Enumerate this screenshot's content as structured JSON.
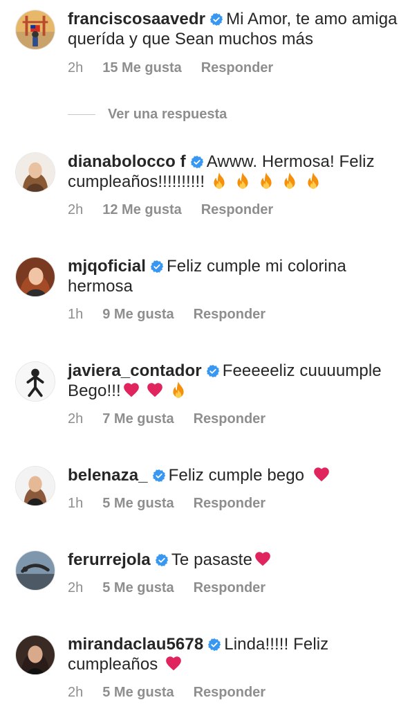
{
  "comments": [
    {
      "username": "franciscosaavedr",
      "text": "Mi Amor, te amo amiga querída y que Sean muchos más",
      "time": "2h",
      "likes": "15 Me gusta",
      "reply": "Responder",
      "emojis": []
    },
    {
      "username": "dianabolocco f",
      "text": "Awww. Hermosa! Feliz cumpleaños!!!!!!!!!!",
      "time": "2h",
      "likes": "12 Me gusta",
      "reply": "Responder",
      "emojis": [
        "fire-icon",
        "fire-icon",
        "fire-icon",
        "fire-icon",
        "fire-icon"
      ]
    },
    {
      "username": "mjqoficial",
      "text": "Feliz cumple mi colorina hermosa",
      "time": "1h",
      "likes": "9 Me gusta",
      "reply": "Responder",
      "emojis": []
    },
    {
      "username": "javiera_contador",
      "text": "Feeeeeliz cuuuumple Bego!!!",
      "time": "2h",
      "likes": "7 Me gusta",
      "reply": "Responder",
      "emojis": [
        "heart-icon",
        "heart-icon",
        "fire-icon"
      ]
    },
    {
      "username": "belenaza_",
      "text": "Feliz cumple bego",
      "time": "1h",
      "likes": "5 Me gusta",
      "reply": "Responder",
      "emojis": [
        "heart-icon"
      ]
    },
    {
      "username": "ferurrejola",
      "text": "Te pasaste",
      "time": "2h",
      "likes": "5 Me gusta",
      "reply": "Responder",
      "emojis": [
        "heart-icon"
      ]
    },
    {
      "username": "mirandaclau5678",
      "text": "Linda!!!!! Feliz cumpleaños",
      "time": "2h",
      "likes": "5 Me gusta",
      "reply": "Responder",
      "emojis": [
        "heart-icon"
      ]
    }
  ],
  "view_replies": "Ver una respuesta",
  "colors": {
    "text": "#262626",
    "meta": "#8e8e8e",
    "verified": "#3897f0",
    "heart": "#e0245e",
    "fire": "#f4900c"
  }
}
